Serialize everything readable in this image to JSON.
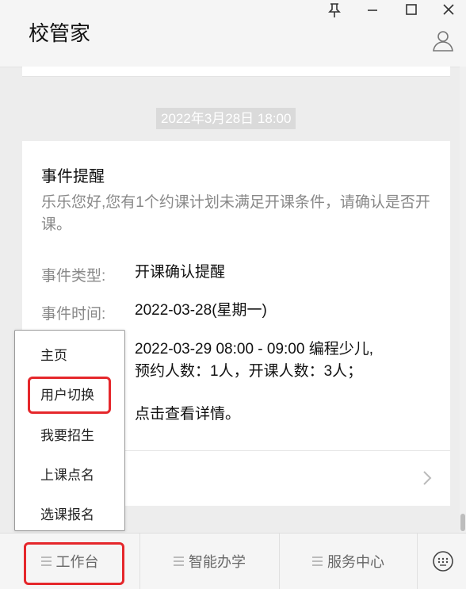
{
  "header": {
    "title": "校管家"
  },
  "message": {
    "timestamp": "2022年3月28日  18:00",
    "title": "事件提醒",
    "description": "乐乐您好,您有1个约课计划未满足开课条件，请确认是否开课。",
    "rows": [
      {
        "label": "事件类型:",
        "value": "开课确认提醒"
      },
      {
        "label": "事件时间:",
        "value": "2022-03-28(星期一)"
      }
    ],
    "detail_line1": "2022-03-29 08:00 - 09:00 编程少儿,",
    "detail_line2": "预约人数：1人，开课人数：3人；",
    "detail_link": "点击查看详情。"
  },
  "menu": {
    "items": [
      "主页",
      "用户切换",
      "我要招生",
      "上课点名",
      "选课报名"
    ],
    "highlighted_item": "用户切换"
  },
  "bottom_nav": {
    "tabs": [
      "工作台",
      "智能办学",
      "服务中心"
    ],
    "highlighted_tab": "工作台"
  },
  "colors": {
    "highlight": "#e5272b",
    "header_bg": "#f5f5f5",
    "page_bg": "#ededed",
    "muted_text": "#888888"
  },
  "icons": [
    "pin-icon",
    "minimize-icon",
    "maximize-icon",
    "close-icon",
    "user-icon",
    "chevron-right-icon",
    "menu-lines-icon",
    "keyboard-icon"
  ]
}
